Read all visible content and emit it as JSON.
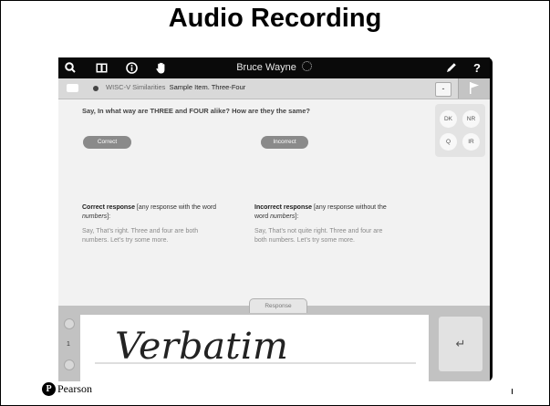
{
  "slide": {
    "title": "Audio Recording"
  },
  "toolbar": {
    "user_name": "Bruce Wayne",
    "icons": [
      "search-icon",
      "book-icon",
      "info-icon",
      "hand-icon",
      "pencil-icon",
      "help-icon"
    ],
    "help_label": "?"
  },
  "breadcrumb": {
    "subtest": "WISC-V Similarities",
    "item": "Sample Item. Three-Four",
    "minimize_label": "-"
  },
  "item": {
    "prompt_say": "Say,",
    "prompt_text": "In what way are THREE and FOUR alike? How are they the same?",
    "correct_button": "Correct",
    "incorrect_button": "Incorrect",
    "codes": [
      "DK",
      "NR",
      "Q",
      "IR"
    ],
    "correct_heading": "Correct response",
    "correct_desc_1": " [any response with the word",
    "correct_desc_word": "numbers",
    "correct_desc_2": "]:",
    "correct_say_1": "Say, That’s right. Three and four are both",
    "correct_say_2": "numbers. Let’s try some more.",
    "incorrect_heading": "Incorrect response",
    "incorrect_desc_1": " [any response without the",
    "incorrect_desc_2a": "word ",
    "incorrect_desc_word": "numbers",
    "incorrect_desc_2b": "]:",
    "incorrect_say_1": "Say, That’s not quite right. Three and four are",
    "incorrect_say_2": "both numbers. Let’s try some more."
  },
  "response": {
    "tab_label": "Response",
    "handwriting": "Verbatim",
    "page_number": "1",
    "enter_label": "↵"
  },
  "footer": {
    "brand": "Pearson",
    "brand_mark": "P"
  },
  "colors": {
    "toolbar_bg": "#0a0a0a",
    "button_gray": "#8a8a8a",
    "content_bg": "#f2f2f2"
  }
}
